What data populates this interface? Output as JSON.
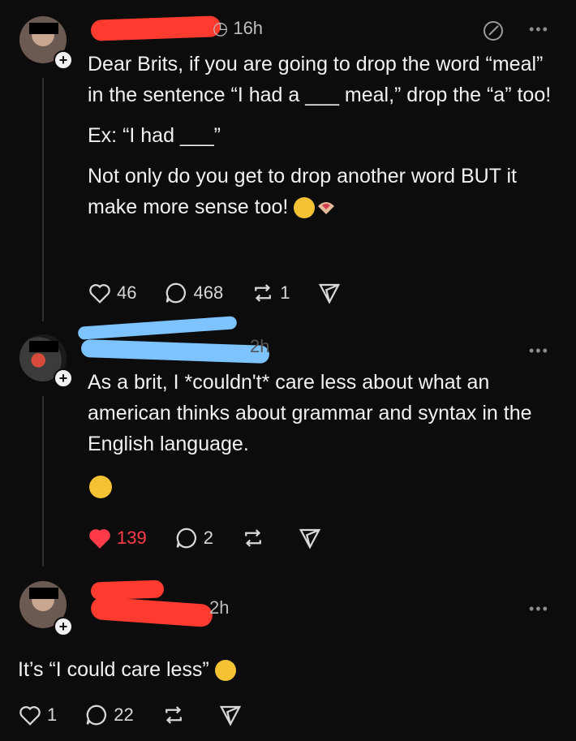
{
  "posts": [
    {
      "time": "16h",
      "paragraphs": [
        "Dear Brits, if you are going to drop the word “meal” in the sentence “I had a ___ meal,” drop the “a” too!",
        "Ex: “I had ___”",
        "Not only do you get to drop another word BUT it make more sense too!"
      ],
      "likes": "46",
      "replies": "468",
      "reposts": "1",
      "icons": [
        "heart-outline-icon",
        "comment-icon",
        "repost-icon",
        "share-icon"
      ]
    },
    {
      "time": "2h",
      "paragraphs": [
        "As a brit, I *couldn't* care less about what an american thinks about grammar and syntax in the English language."
      ],
      "likes": "139",
      "replies": "2",
      "liked_color": "#ff3b4a"
    },
    {
      "time": "2h",
      "paragraphs": [
        "It’s “I could care less”"
      ],
      "likes": "1",
      "replies": "22"
    }
  ],
  "colors": {
    "background": "#0c0c0c",
    "text": "#f2f2f2",
    "redaction_red": "#ff3a2e",
    "redaction_blue": "#7cc3ff"
  }
}
